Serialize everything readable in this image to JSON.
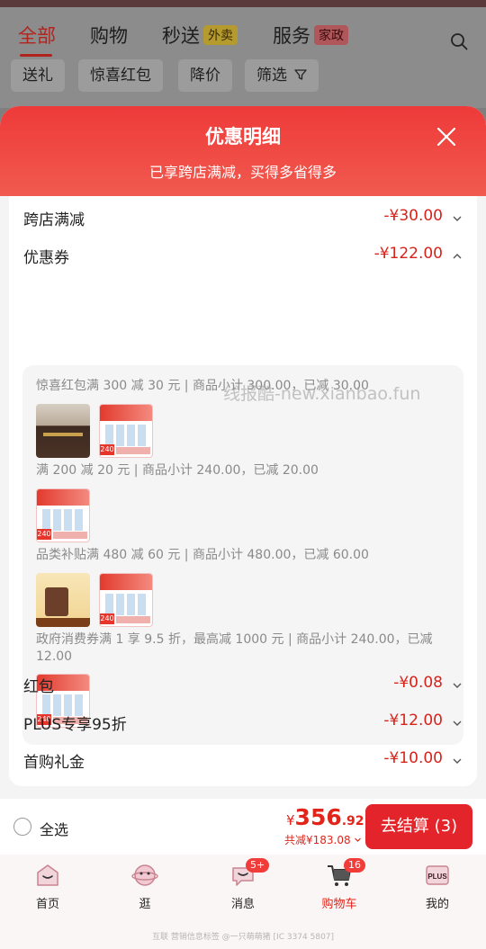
{
  "header": {
    "tabs": [
      {
        "label": "全部",
        "active": true
      },
      {
        "label": "购物",
        "active": false
      },
      {
        "label": "秒送",
        "badge": "外卖"
      },
      {
        "label": "服务",
        "badge": "家政"
      }
    ],
    "filters": [
      "送礼",
      "惊喜红包",
      "降价",
      "筛选"
    ]
  },
  "sheet": {
    "title": "优惠明细",
    "subtitle": "已享跨店满减，买得多省得多",
    "rows": [
      {
        "label": "跨店满减",
        "value": "-¥30.00"
      },
      {
        "label": "优惠券",
        "value": "-¥122.00"
      },
      {
        "label": "红包",
        "value": "-¥0.08"
      },
      {
        "label": "PLUS专享95折",
        "value": "-¥12.00"
      },
      {
        "label": "首购礼金",
        "value": "-¥10.00"
      }
    ],
    "coupons": [
      {
        "text": "惊喜红包满 300 减 30 元 | 商品小计 300.00，已减 30.00"
      },
      {
        "text": "满 200 减 20 元 | 商品小计 240.00，已减 20.00"
      },
      {
        "text": "品类补贴满 480 减 60 元 | 商品小计 480.00，已减 60.00"
      },
      {
        "text": "政府消费券满 1 享 9.5 折，最高减 1000 元 | 商品小计 240.00，已减 12.00"
      }
    ],
    "thumb_tag": "240",
    "watermark": "线报酷-new.xianbao.fun"
  },
  "checkout": {
    "select_all": "全选",
    "currency": "¥",
    "price_int": "356",
    "price_dec": ".92",
    "saved": "共减¥183.08",
    "button": "去结算 (3)"
  },
  "tabbar": {
    "items": [
      {
        "label": "首页",
        "icon": "home-icon"
      },
      {
        "label": "逛",
        "icon": "browse-icon"
      },
      {
        "label": "消息",
        "icon": "message-icon",
        "badge": "5+"
      },
      {
        "label": "购物车",
        "icon": "cart-icon",
        "badge": "16",
        "active": true
      },
      {
        "label": "我的",
        "icon": "plus-member-icon",
        "icon_text": "PLUS"
      }
    ]
  },
  "footer_text": "互联 营销信息标签 @一只萌萌猪 [IC 3374 5807]",
  "colors": {
    "accent": "#e1251b",
    "header_red": "#ee3a3a"
  }
}
